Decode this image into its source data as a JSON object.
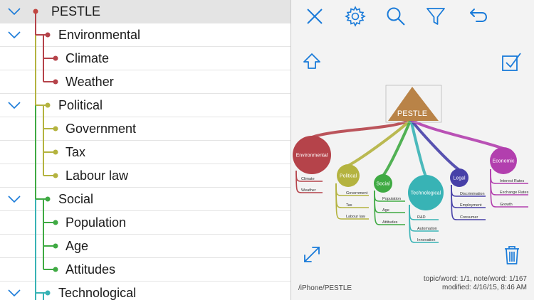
{
  "outline": {
    "rows": [
      {
        "label": "PESTLE",
        "expanded": true,
        "selected": true
      },
      {
        "label": "Environmental",
        "expanded": true
      },
      {
        "label": "Climate"
      },
      {
        "label": "Weather"
      },
      {
        "label": "Political",
        "expanded": true
      },
      {
        "label": "Government"
      },
      {
        "label": "Tax"
      },
      {
        "label": "Labour law"
      },
      {
        "label": "Social",
        "expanded": true
      },
      {
        "label": "Population"
      },
      {
        "label": "Age"
      },
      {
        "label": "Attitudes"
      },
      {
        "label": "Technological",
        "expanded": true
      }
    ]
  },
  "toolbar": {
    "icons": [
      "close-icon",
      "gear-icon",
      "search-icon",
      "filter-icon",
      "undo-icon"
    ]
  },
  "map": {
    "root": "PESTLE",
    "branches": [
      {
        "name": "Environmental",
        "color": "#b5434a",
        "children": [
          "Climate",
          "Weather"
        ]
      },
      {
        "name": "Political",
        "color": "#b4b33f",
        "children": [
          "Government",
          "Tax",
          "Labour law"
        ]
      },
      {
        "name": "Social",
        "color": "#3faa43",
        "children": [
          "Population",
          "Age",
          "Attitudes"
        ]
      },
      {
        "name": "Technological",
        "color": "#38b3b5",
        "children": [
          "R&D",
          "Automation",
          "Innovation"
        ]
      },
      {
        "name": "Legal",
        "color": "#4740a8",
        "children": [
          "Discrimination",
          "Employment",
          "Consumer"
        ]
      },
      {
        "name": "Economic",
        "color": "#b23fae",
        "children": [
          "Interest Rates",
          "Exchange Rates",
          "Growth"
        ]
      }
    ],
    "root_color": "#b98347",
    "path": "/iPhone/PESTLE",
    "stats": "topic/word: 1/1, note/word: 1/167",
    "modified": "modified: 4/16/15, 8:46 AM"
  },
  "colors": {
    "accent": "#1a7bd9",
    "root_branch": "#c0443f",
    "environmental": "#b5434a",
    "political": "#b4b33f",
    "social": "#3faa43",
    "technological": "#38b3b5"
  }
}
